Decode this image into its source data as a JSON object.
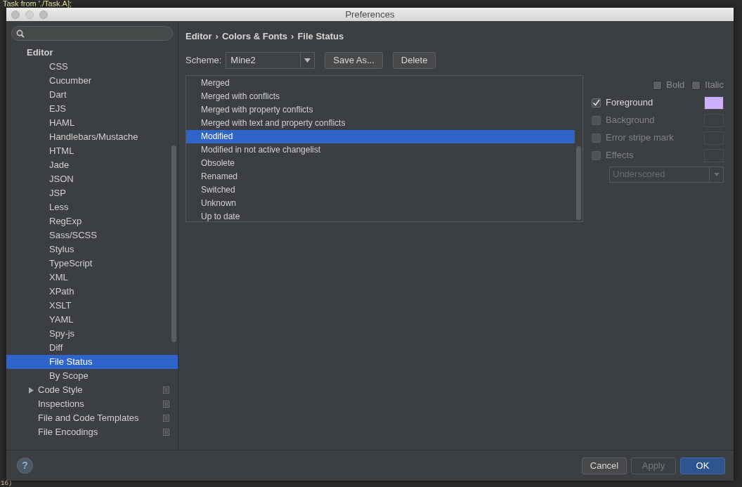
{
  "editor_background": {
    "top_line": "Task from './Task.A];",
    "bottom_line": "16)"
  },
  "window": {
    "title": "Preferences"
  },
  "tree": [
    {
      "label": "Editor",
      "selected": false,
      "children": [
        {
          "children": [
            {
              "label": "CSS",
              "selected": false
            },
            {
              "label": "Cucumber",
              "selected": false
            },
            {
              "label": "Dart",
              "selected": false
            },
            {
              "label": "EJS",
              "selected": false
            },
            {
              "label": "HAML",
              "selected": false
            },
            {
              "label": "Handlebars/Mustache",
              "selected": false
            },
            {
              "label": "HTML",
              "selected": false
            },
            {
              "label": "Jade",
              "selected": false
            },
            {
              "label": "JSON",
              "selected": false
            },
            {
              "label": "JSP",
              "selected": false
            },
            {
              "label": "Less",
              "selected": false
            },
            {
              "label": "RegExp",
              "selected": false
            },
            {
              "label": "Sass/SCSS",
              "selected": false
            },
            {
              "label": "Stylus",
              "selected": false
            },
            {
              "label": "TypeScript",
              "selected": false
            },
            {
              "label": "XML",
              "selected": false
            },
            {
              "label": "XPath",
              "selected": false
            },
            {
              "label": "XSLT",
              "selected": false
            },
            {
              "label": "YAML",
              "selected": false
            },
            {
              "label": "Spy-js",
              "selected": false
            },
            {
              "label": "Diff",
              "selected": false
            },
            {
              "label": "File Status",
              "selected": true
            },
            {
              "label": "By Scope",
              "selected": false
            }
          ]
        },
        {
          "label": "Code Style",
          "selected": false,
          "expanded": false,
          "project_scope": true
        },
        {
          "label": "Inspections",
          "selected": false,
          "project_scope": true
        },
        {
          "label": "File and Code Templates",
          "selected": false,
          "project_scope": true
        },
        {
          "label": "File Encodings",
          "selected": false,
          "project_scope": true
        }
      ]
    }
  ],
  "breadcrumb": [
    "Editor",
    "Colors & Fonts",
    "File Status"
  ],
  "breadcrumb_separator": "›",
  "scheme": {
    "label": "Scheme:",
    "value": "Mine2",
    "buttons": [
      "Save As...",
      "Delete"
    ]
  },
  "statuses": [
    {
      "label": "Merged",
      "selected": false
    },
    {
      "label": "Merged with conflicts",
      "selected": false
    },
    {
      "label": "Merged with property conflicts",
      "selected": false
    },
    {
      "label": "Merged with text and property conflicts",
      "selected": false
    },
    {
      "label": "Modified",
      "selected": true
    },
    {
      "label": "Modified in not active changelist",
      "selected": false
    },
    {
      "label": "Obsolete",
      "selected": false
    },
    {
      "label": "Renamed",
      "selected": false
    },
    {
      "label": "Switched",
      "selected": false
    },
    {
      "label": "Unknown",
      "selected": false
    },
    {
      "label": "Up to date",
      "selected": false
    }
  ],
  "font_style": [
    {
      "label": "Bold",
      "checked": false
    },
    {
      "label": "Italic",
      "checked": false
    }
  ],
  "attributes": [
    {
      "label": "Foreground",
      "checked": true,
      "color": "#cdb0fb"
    },
    {
      "label": "Background",
      "checked": false
    },
    {
      "label": "Error stripe mark",
      "checked": false
    },
    {
      "label": "Effects",
      "checked": false
    }
  ],
  "effect_type": {
    "value": "Underscored",
    "disabled": true
  },
  "footer": {
    "help": "?",
    "buttons": [
      {
        "label": "Cancel",
        "kind": "normal",
        "disabled": false
      },
      {
        "label": "Apply",
        "kind": "normal",
        "disabled": true
      },
      {
        "label": "OK",
        "kind": "default",
        "disabled": false
      }
    ]
  }
}
